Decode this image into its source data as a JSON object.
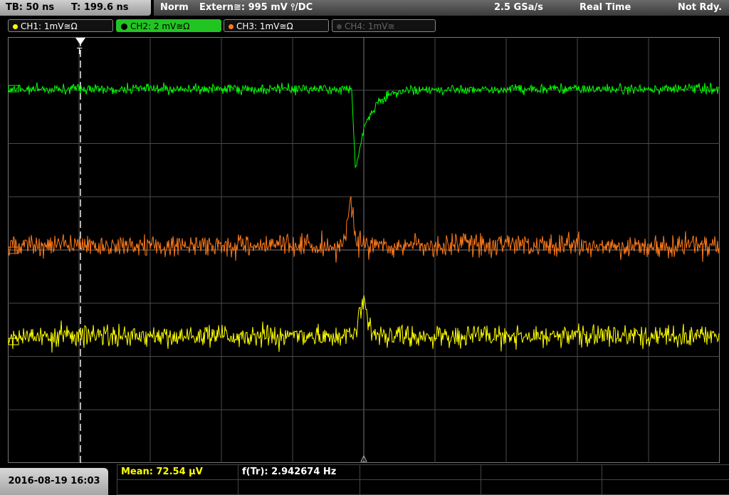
{
  "topbar": {
    "tb": "TB: 50 ns",
    "t": "T: 199.6 ns",
    "mode": "Norm",
    "trigger": "Extern≅: 995 mV ⫯/DC",
    "rate": "2.5 GSa/s",
    "acq": "Real Time",
    "ready": "Not Rdy."
  },
  "channels": [
    {
      "label": "CH1: 1mV≅Ω",
      "color": "#ffff00"
    },
    {
      "label": "CH2: 2 mV≅Ω",
      "color": "#00ff00"
    },
    {
      "label": "CH3: 1mV≅Ω",
      "color": "#ff7a1a"
    },
    {
      "label": "CH4: 1mV≅",
      "color": "#666666"
    }
  ],
  "date": "2016-08-19 16:03",
  "measurements": {
    "mean": "Mean: 72.54 µV",
    "freq": "f(Tr): 2.942674 Hz"
  },
  "cursor_marker": "T",
  "colors": {
    "ch1": "#ffff00",
    "ch2": "#00ff00",
    "ch3": "#ff7a1a",
    "grid": "#5a5a5a"
  }
}
